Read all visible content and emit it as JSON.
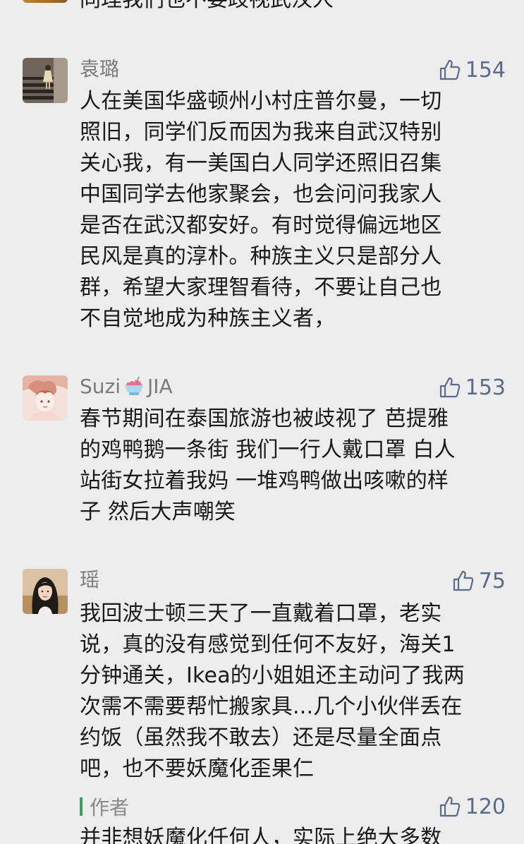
{
  "top_cut": {
    "text": "同理我们也不要歧视武汉人"
  },
  "comments": [
    {
      "name": "袁璐",
      "likes": "154",
      "lines": [
        "人在美国华盛顿州小村庄普尔曼，一切",
        "照旧，同学们反而因为我来自武汉特别",
        "关心我，有一美国白人同学还照旧召集",
        "中国同学去他家聚会，也会问问我家人",
        "是否在武汉都安好。有时觉得偏远地区",
        "民风是真的淳朴。种族主义只是部分人",
        "群，希望大家理智看待，不要让自己也",
        "不自觉地成为种族主义者，"
      ]
    },
    {
      "name_prefix": "Suzi",
      "name_suffix": "JIA",
      "name_emoji": "shaved-ice-emoji",
      "likes": "153",
      "lines": [
        "春节期间在泰国旅游也被歧视了 芭提雅",
        "的鸡鸭鹅一条街 我们一行人戴口罩 白人",
        "站街女拉着我妈 一堆鸡鸭做出咳嗽的样",
        "子 然后大声嘲笑"
      ]
    },
    {
      "name": "瑶",
      "likes": "75",
      "lines": [
        "我回波士顿三天了一直戴着口罩，老实",
        "说，真的没有感觉到任何不友好，海关1",
        "分钟通关，Ikea的小姐姐还主动问了我两",
        "次需不需要帮忙搬家具...几个小伙伴丢在",
        "约饭（虽然我不敢去）还是尽量全面点",
        "吧，也不要妖魔化歪果仁"
      ]
    }
  ],
  "author_reply": {
    "label": "作者",
    "likes": "120",
    "line": "并非想妖魔化任何人，实际上绝大多数"
  },
  "colors": {
    "background": "#ededed",
    "text": "#1a1a1a",
    "name": "#7b7b7b",
    "like": "#5b6b8c",
    "author_bar": "#3aa356"
  }
}
